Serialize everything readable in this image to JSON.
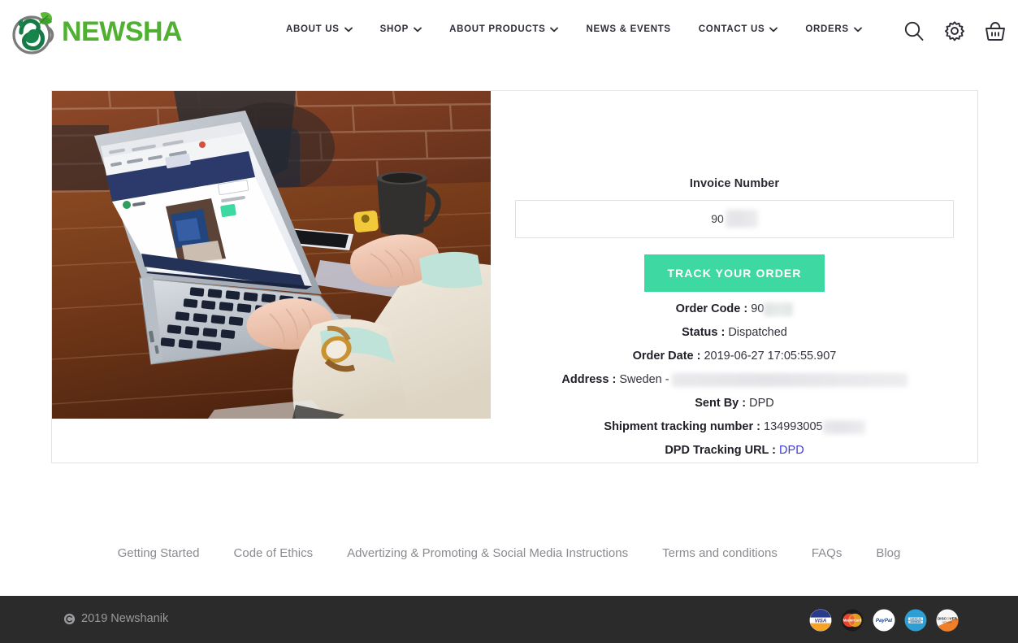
{
  "brand": {
    "name": "NEWSHA",
    "logo_icon": "newsha-swan-teapot-logo",
    "logo_text_color": "#4fb031",
    "logo_mark_color": "#1c8a4e"
  },
  "header": {
    "nav": [
      {
        "label": "ABOUT US",
        "has_dropdown": true
      },
      {
        "label": "SHOP",
        "has_dropdown": true
      },
      {
        "label": "ABOUT PRODUCTS",
        "has_dropdown": true
      },
      {
        "label": "NEWS & EVENTS",
        "has_dropdown": false
      },
      {
        "label": "CONTACT US",
        "has_dropdown": true
      },
      {
        "label": "ORDERS",
        "has_dropdown": true
      }
    ],
    "icons": [
      {
        "name": "search-icon"
      },
      {
        "name": "gear-icon"
      },
      {
        "name": "basket-icon"
      }
    ]
  },
  "main": {
    "photo_alt": "person typing on laptop at wooden desk with brick wall",
    "invoice": {
      "label": "Invoice Number",
      "value": "90",
      "value_redacted": true,
      "placeholder": "Invoice Number"
    },
    "track_button": "TRACK YOUR ORDER",
    "details": [
      {
        "label": "Order Code :",
        "value": "90",
        "redacted": true,
        "redact_width": 36,
        "link": false
      },
      {
        "label": "Status :",
        "value": "Dispatched",
        "redacted": false,
        "link": false
      },
      {
        "label": "Order Date :",
        "value": "2019-06-27 17:05:55.907",
        "redacted": false,
        "link": false
      },
      {
        "label": "Address :",
        "value": "Sweden -",
        "redacted": true,
        "redact_width": 290,
        "link": false
      },
      {
        "label": "Sent By :",
        "value": "DPD",
        "redacted": false,
        "link": false
      },
      {
        "label": "Shipment tracking number :",
        "value": "134993005",
        "redacted": true,
        "redact_width": 52,
        "link": false
      },
      {
        "label": "DPD Tracking URL :",
        "value": "DPD",
        "redacted": false,
        "link": true
      }
    ]
  },
  "footer": {
    "links": [
      "Getting Started",
      "Code of Ethics",
      "Advertizing & Promoting & Social Media Instructions",
      "Terms and conditions",
      "FAQs",
      "Blog"
    ],
    "copyright": "2019 Newshanik",
    "copyright_icon": "copyright-icon",
    "payment_methods": [
      {
        "name": "visa-badge",
        "label": "VISA"
      },
      {
        "name": "mastercard-badge",
        "label": "MasterCard"
      },
      {
        "name": "paypal-badge",
        "label": "PayPal"
      },
      {
        "name": "amex-badge",
        "label": "AMERICAN EXPRESS"
      },
      {
        "name": "discover-badge",
        "label": "DISCOVER"
      }
    ]
  },
  "colors": {
    "accent_green": "#3ed9a3",
    "brand_green": "#4fb031",
    "footer_bar": "#2b2b2b",
    "link_blue": "#3b3bdd"
  }
}
